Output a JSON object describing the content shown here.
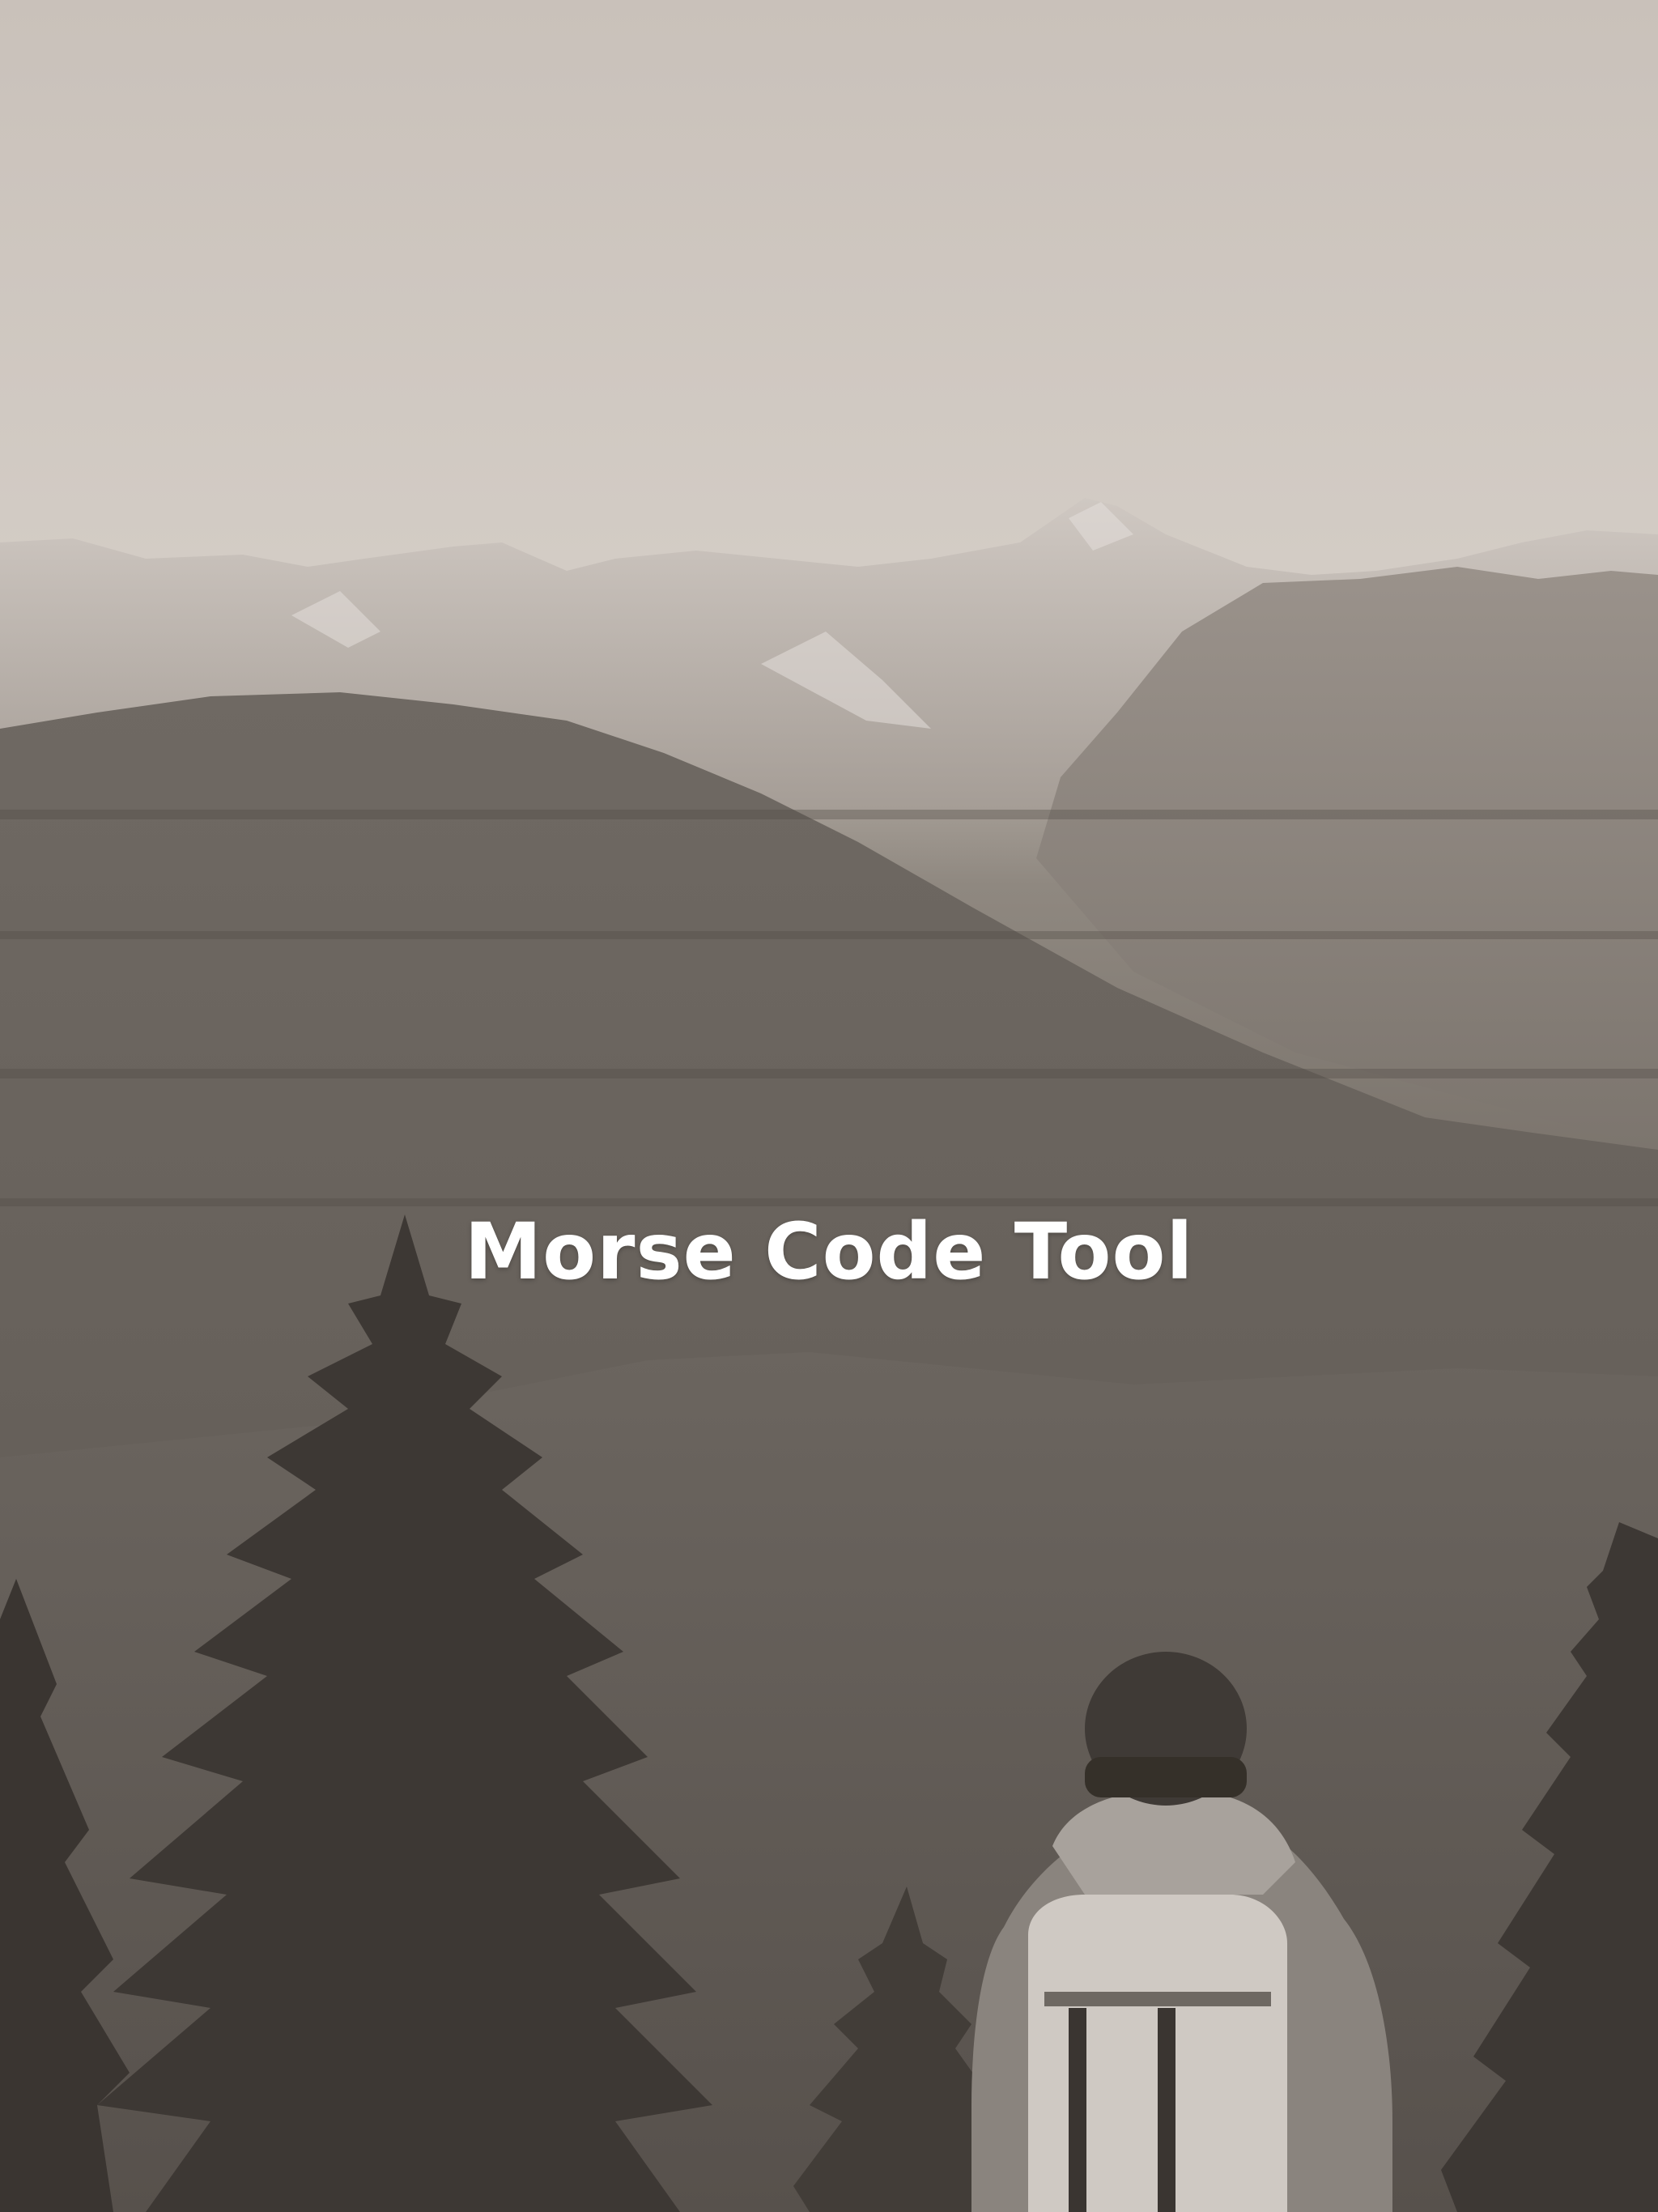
{
  "title": "Morse Code Tool",
  "colors": {
    "sky": "#cdc6bf",
    "distant_mountains": "#b8b0a8",
    "forest": "#5f5953",
    "title_text": "#ffffff"
  }
}
